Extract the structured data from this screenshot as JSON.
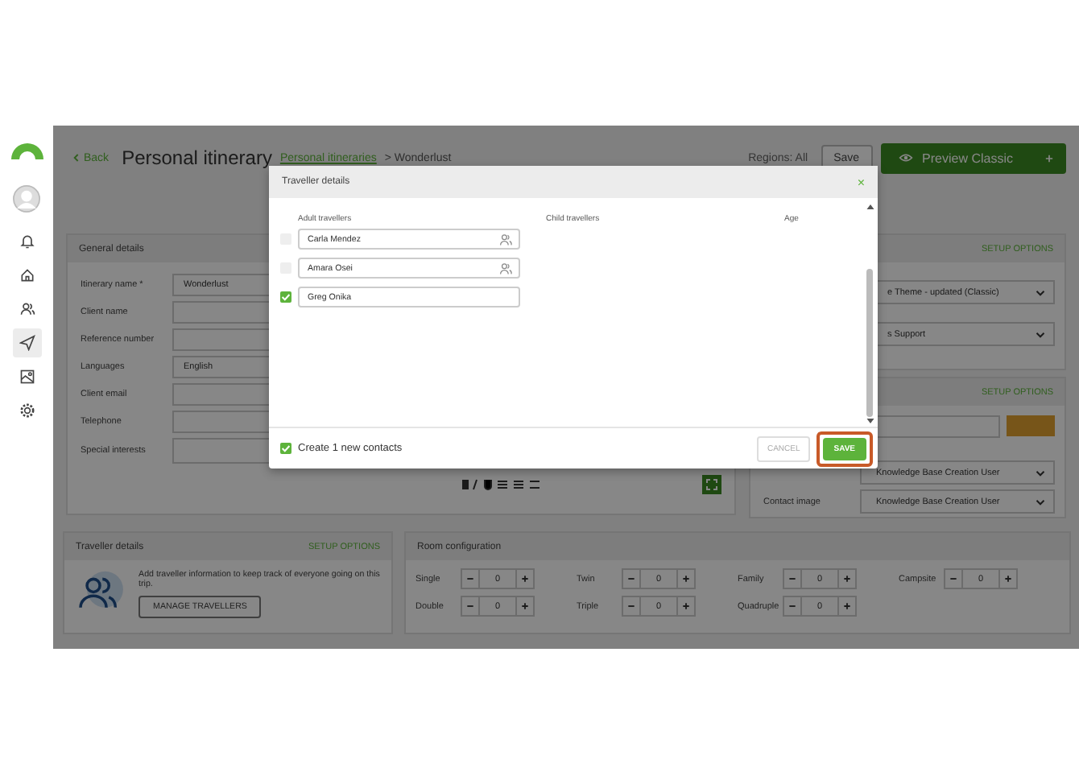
{
  "sidebar": {
    "items": [
      {
        "kind": "bell",
        "selected": false
      },
      {
        "kind": "home",
        "selected": false
      },
      {
        "kind": "users",
        "selected": false
      },
      {
        "kind": "send",
        "selected": true
      },
      {
        "kind": "image",
        "selected": false
      },
      {
        "kind": "gear",
        "selected": false
      }
    ]
  },
  "header": {
    "back": "Back",
    "title": "Personal itinerary",
    "breadcrumb": [
      "Personal itineraries",
      "Wonderlust"
    ],
    "breadcrumb_separator": ">",
    "regions": "Regions: All",
    "save": "Save",
    "preview": "Preview Classic"
  },
  "general_details": {
    "title": "General details",
    "fields": [
      {
        "label": "Itinerary name *",
        "value": "Wonderlust"
      },
      {
        "label": "Client name"
      },
      {
        "label": "Reference number"
      },
      {
        "label": "Languages",
        "value": "English"
      },
      {
        "label": "Client email"
      },
      {
        "label": "Telephone"
      },
      {
        "label": "Special interests"
      }
    ]
  },
  "theme_panel": {
    "setup": "SETUP OPTIONS",
    "selects": [
      "e Theme - updated (Classic)",
      "s Support"
    ]
  },
  "contact_panel": {
    "setup": "SETUP OPTIONS",
    "selects": [
      {
        "value": "Knowledge Base Creation User"
      },
      {
        "label": "Contact image",
        "value": "Knowledge Base Creation User"
      }
    ]
  },
  "traveller_details": {
    "title": "Traveller details",
    "setup": "SETUP OPTIONS",
    "text": "Add traveller information to keep track of everyone going on this trip.",
    "button": "MANAGE TRAVELLERS"
  },
  "room_configuration": {
    "title": "Room configuration",
    "rooms": [
      {
        "label": "Single",
        "value": "0"
      },
      {
        "label": "Twin",
        "value": "0"
      },
      {
        "label": "Family",
        "value": "0"
      },
      {
        "label": "Campsite",
        "value": "0"
      },
      {
        "label": "Double",
        "value": "0"
      },
      {
        "label": "Triple",
        "value": "0"
      },
      {
        "label": "Quadruple",
        "value": "0"
      }
    ]
  },
  "modal": {
    "title": "Traveller details",
    "close": "×",
    "columns": [
      "Adult travellers",
      "Child travellers",
      "Age"
    ],
    "travellers": [
      {
        "name": "Carla Mendez",
        "checked": false,
        "contact_icon": true
      },
      {
        "name": "Amara Osei",
        "checked": false,
        "contact_icon": true
      },
      {
        "name": "Greg Onika",
        "checked": true,
        "contact_icon": false
      }
    ],
    "create_contacts": {
      "label": "Create 1 new contacts",
      "checked": true
    },
    "cancel": "CANCEL",
    "save": {
      "label": "SAVE",
      "highlighted": true
    }
  }
}
